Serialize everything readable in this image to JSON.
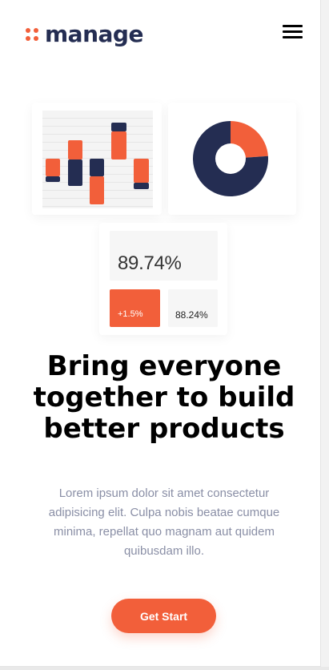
{
  "header": {
    "logo_text": "manage",
    "menu_icon": "hamburger-icon"
  },
  "colors": {
    "accent": "#f25f3a",
    "navy": "#242d52",
    "text_muted": "#8a8fa6"
  },
  "illustration": {
    "bar_chart": {
      "orange_color": "#f25f3a",
      "navy_color": "#242d52"
    },
    "donut_chart": {
      "slices": [
        {
          "color": "#f25f3a",
          "fraction": 0.3
        },
        {
          "color": "#242d52",
          "fraction": 0.7
        }
      ]
    },
    "stats": {
      "main_value": "89.74%",
      "increase_value": "+1.5%",
      "secondary_value": "88.24%"
    }
  },
  "hero": {
    "headline_lines": [
      "Bring everyone",
      "together to build",
      "better products"
    ],
    "description_lines": [
      "Lorem ipsum dolor sit amet consectetur",
      "adipisicing elit. Culpa nobis beatae cumque",
      "minima, repellat quo magnam aut quidem",
      "quibusdam illo."
    ],
    "cta_label": "Get Start"
  }
}
